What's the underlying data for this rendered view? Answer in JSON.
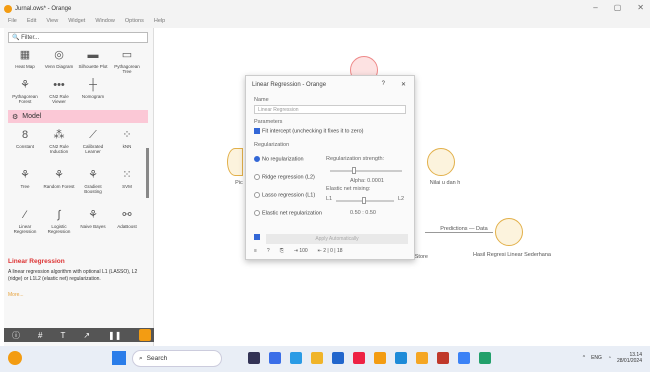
{
  "window": {
    "title": "Jurnal.ows* - Orange",
    "controls": [
      "–",
      "▢",
      "✕"
    ]
  },
  "menu": [
    "File",
    "Edit",
    "View",
    "Widget",
    "Window",
    "Options",
    "Help"
  ],
  "left_panel": {
    "filter_placeholder": "Filter...",
    "widgets_row1": [
      "Heat Map",
      "Venn Diagram",
      "Silhouette Plot",
      "Pythagorean Tree"
    ],
    "widgets_row2": [
      "Pythagorean Forest",
      "CN2 Rule Viewer",
      "Nomogram"
    ],
    "category": "Model",
    "model_widgets_row1": [
      "Constant",
      "CN2 Rule Induction",
      "Calibrated Learner",
      "kNN"
    ],
    "model_widgets_row2": [
      "Tree",
      "Random Forest",
      "Gradient Boosting",
      "SVM"
    ],
    "model_widgets_row3": [
      "Linear Regression",
      "Logistic Regression",
      "Naive Bayes",
      "AdaBoost"
    ],
    "help_title": "Linear Regression",
    "help_text": "A linear regression algorithm with optional L1 (LASSO), L2 (ridge) or L1L2 (elastic net) regularization.",
    "help_more": "More..."
  },
  "canvas": {
    "node_labels": [
      "Nilai u dan h",
      "Predictions — Data",
      "Hasil Regresi Linear Sederhana",
      "Pic",
      "and Store"
    ]
  },
  "dialog": {
    "title": "Linear Regression - Orange",
    "name_label": "Name",
    "name_value": "Linear Regression",
    "parameters_label": "Parameters",
    "fit_intercept_label": "Fit intercept (unchecking it fixes it to zero)",
    "regularization_label": "Regularization",
    "options": [
      "No regularization",
      "Ridge regression (L2)",
      "Lasso regression (L1)",
      "Elastic net regularization"
    ],
    "strength_label": "Regularization strength:",
    "alpha_label": "Alpha: 0.0001",
    "elastic_label": "Elastic net mixing:",
    "l1": "L1",
    "l2": "L2",
    "mix_value": "0.50 : 0.50",
    "apply_label": "Apply Automatically",
    "status": [
      "100",
      "2 | 0 | 18"
    ]
  },
  "taskbar": {
    "search": "Search",
    "lang": "ENG",
    "time": "13.14",
    "date": "28/01/2024"
  }
}
